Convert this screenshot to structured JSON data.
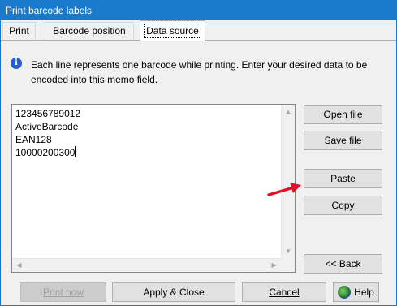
{
  "window": {
    "title": "Print barcode labels"
  },
  "tabs": [
    {
      "label": "Print"
    },
    {
      "label": "Barcode position"
    },
    {
      "label": "Data source"
    }
  ],
  "info": {
    "icon": "info-icon",
    "text": "Each line represents one barcode while printing. Enter your desired data to be encoded into this memo field."
  },
  "memo": {
    "lines": [
      "123456789012",
      "ActiveBarcode",
      "EAN128",
      "10000200300"
    ]
  },
  "side_buttons": {
    "open_file": "Open file",
    "save_file": "Save file",
    "paste": "Paste",
    "copy": "Copy",
    "back": "<< Back"
  },
  "bottom_buttons": {
    "print_now": "Print now",
    "apply_close": "Apply & Close",
    "cancel": "Cancel",
    "help": "Help"
  },
  "colors": {
    "titlebar": "#1979ca",
    "arrow": "#e0102a"
  }
}
